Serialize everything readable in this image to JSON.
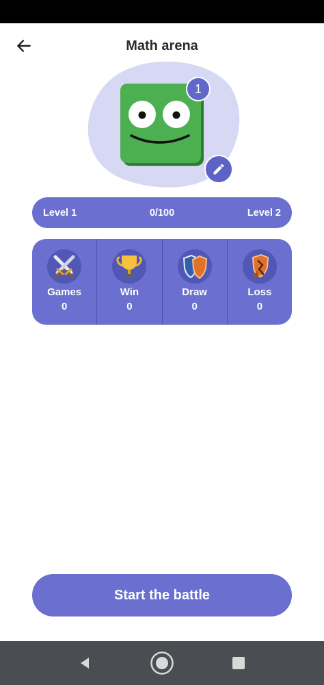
{
  "header": {
    "title": "Math arena",
    "back_icon": "arrow-left-icon"
  },
  "avatar": {
    "level_badge": "1",
    "color": "#4cb050",
    "edit_icon": "pencil-icon"
  },
  "level_progress": {
    "current_level": "Level 1",
    "progress_text": "0/100",
    "next_level": "Level 2",
    "progress_fraction": 0
  },
  "stats": [
    {
      "label": "Games",
      "value": "0",
      "icon": "crossed-swords-icon"
    },
    {
      "label": "Win",
      "value": "0",
      "icon": "trophy-icon"
    },
    {
      "label": "Draw",
      "value": "0",
      "icon": "shields-icon"
    },
    {
      "label": "Loss",
      "value": "0",
      "icon": "broken-shield-icon"
    }
  ],
  "start_button": {
    "label": "Start the battle"
  },
  "colors": {
    "accent": "#6a6fd0",
    "blob": "#d6d8f4",
    "nav_bar": "#4a4d52"
  },
  "system_nav": {
    "back_icon": "nav-back-icon",
    "home_icon": "nav-home-icon",
    "recents_icon": "nav-recents-icon"
  }
}
